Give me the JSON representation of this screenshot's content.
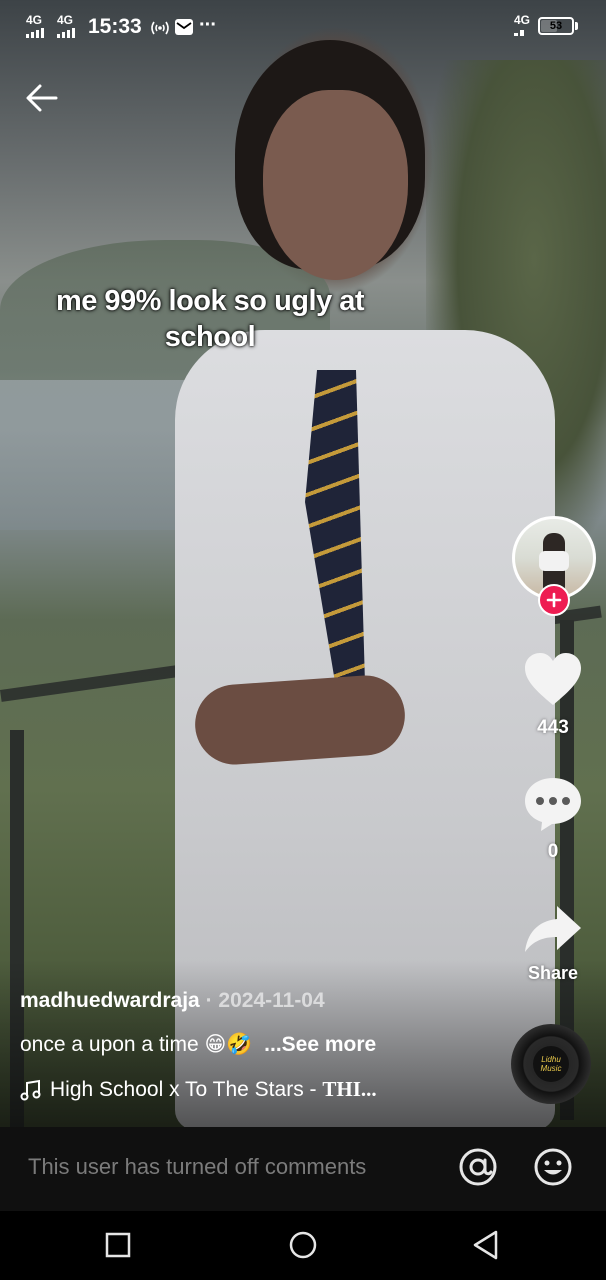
{
  "status_bar": {
    "signal_1": "4G",
    "signal_2": "4G",
    "time": "15:33",
    "extra_icons": "···",
    "network_right": "4G",
    "battery_percent": "53",
    "battery_level": 0.53
  },
  "video": {
    "overlay_text": "me 99% look so ugly at school"
  },
  "actions": {
    "likes": "443",
    "comments": "0",
    "share_label": "Share"
  },
  "caption": {
    "username": "madhuedwardraja",
    "separator": " · ",
    "date": "2024-11-04",
    "description": "once a upon a time 😁🤣",
    "see_more": "...See more",
    "music_prefix": "High School x To The Stars - ",
    "music_suffix": "THI..."
  },
  "disc": {
    "label": "Lidhu Music"
  },
  "comment_bar": {
    "message": "This user has turned off comments"
  },
  "icons": {
    "back": "arrow-left-icon",
    "like": "heart-icon",
    "comment": "speech-bubble-icon",
    "share": "share-arrow-icon",
    "mention": "at-sign-icon",
    "emoji": "smiley-icon",
    "music": "music-note-icon",
    "follow": "plus-icon"
  },
  "colors": {
    "follow_badge": "#ee1d52",
    "comment_bar_bg": "#101010",
    "comment_text": "#7b7b7b"
  }
}
